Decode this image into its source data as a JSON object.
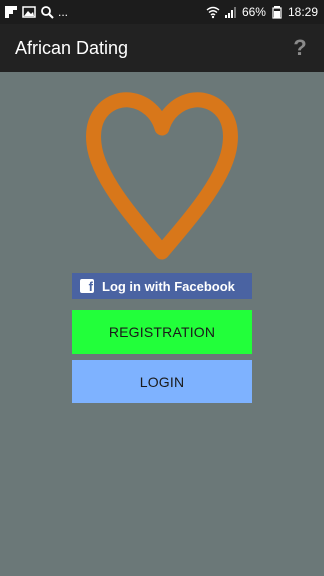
{
  "status_bar": {
    "battery": "66%",
    "time": "18:29",
    "more": "..."
  },
  "app_bar": {
    "title": "African Dating",
    "help_label": "?"
  },
  "main": {
    "facebook_label": "Log in with Facebook",
    "facebook_icon_glyph": "f",
    "register_label": "REGISTRATION",
    "login_label": "LOGIN"
  },
  "colors": {
    "background": "#6b7878",
    "app_bar": "#222222",
    "heart": "#d8771a",
    "facebook": "#4a63a2",
    "registration": "#22ff3a",
    "login": "#7eb2ff"
  },
  "icons": {
    "status_left": [
      "flipboard-icon",
      "image-icon",
      "search-icon"
    ],
    "status_right": [
      "wifi-icon",
      "signal-icon",
      "battery-icon"
    ],
    "logo": "heart-icon"
  }
}
